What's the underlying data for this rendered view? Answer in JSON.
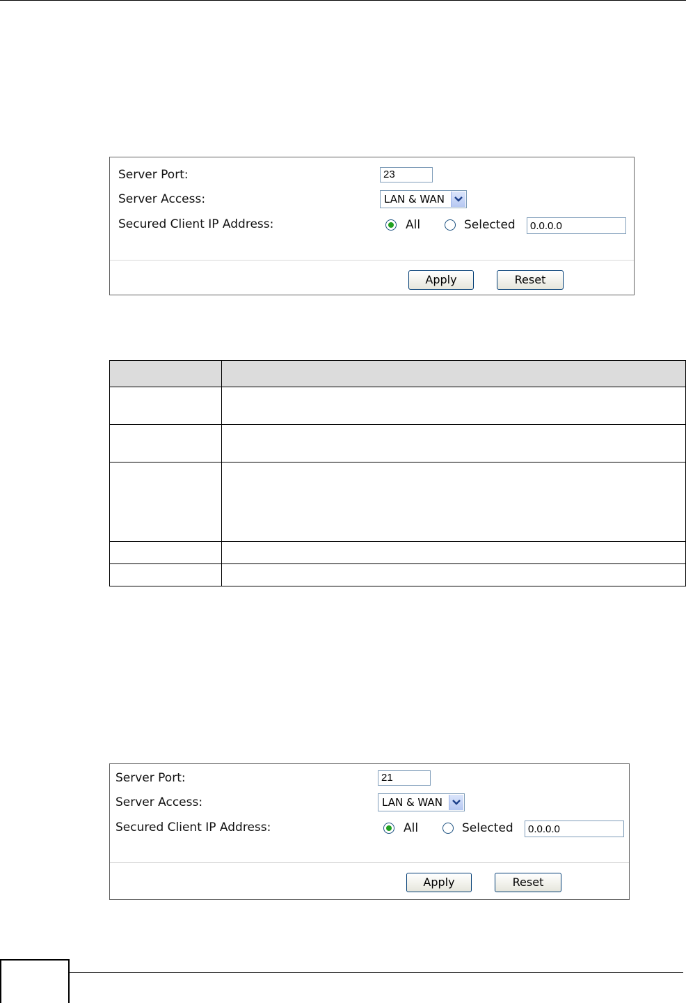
{
  "panel1": {
    "server_port_label": "Server Port:",
    "server_port_value": "23",
    "server_access_label": "Server Access:",
    "server_access_value": "LAN & WAN",
    "secured_ip_label": "Secured Client IP Address:",
    "radio_all_label": "All",
    "radio_selected_label": "Selected",
    "ip_value": "0.0.0.0",
    "apply_label": "Apply",
    "reset_label": "Reset"
  },
  "panel2": {
    "server_port_label": "Server Port:",
    "server_port_value": "21",
    "server_access_label": "Server Access:",
    "server_access_value": "LAN & WAN",
    "secured_ip_label": "Secured Client IP Address:",
    "radio_all_label": "All",
    "radio_selected_label": "Selected",
    "ip_value": "0.0.0.0",
    "apply_label": "Apply",
    "reset_label": "Reset"
  },
  "colors": {
    "header_fill": "#dcdcdc",
    "radio_checked": "#21a121",
    "button_border": "#003c74"
  },
  "icons": {
    "dropdown": "chevron-down-icon",
    "radio_checked": "radio-checked-icon",
    "radio_unchecked": "radio-unchecked-icon"
  }
}
